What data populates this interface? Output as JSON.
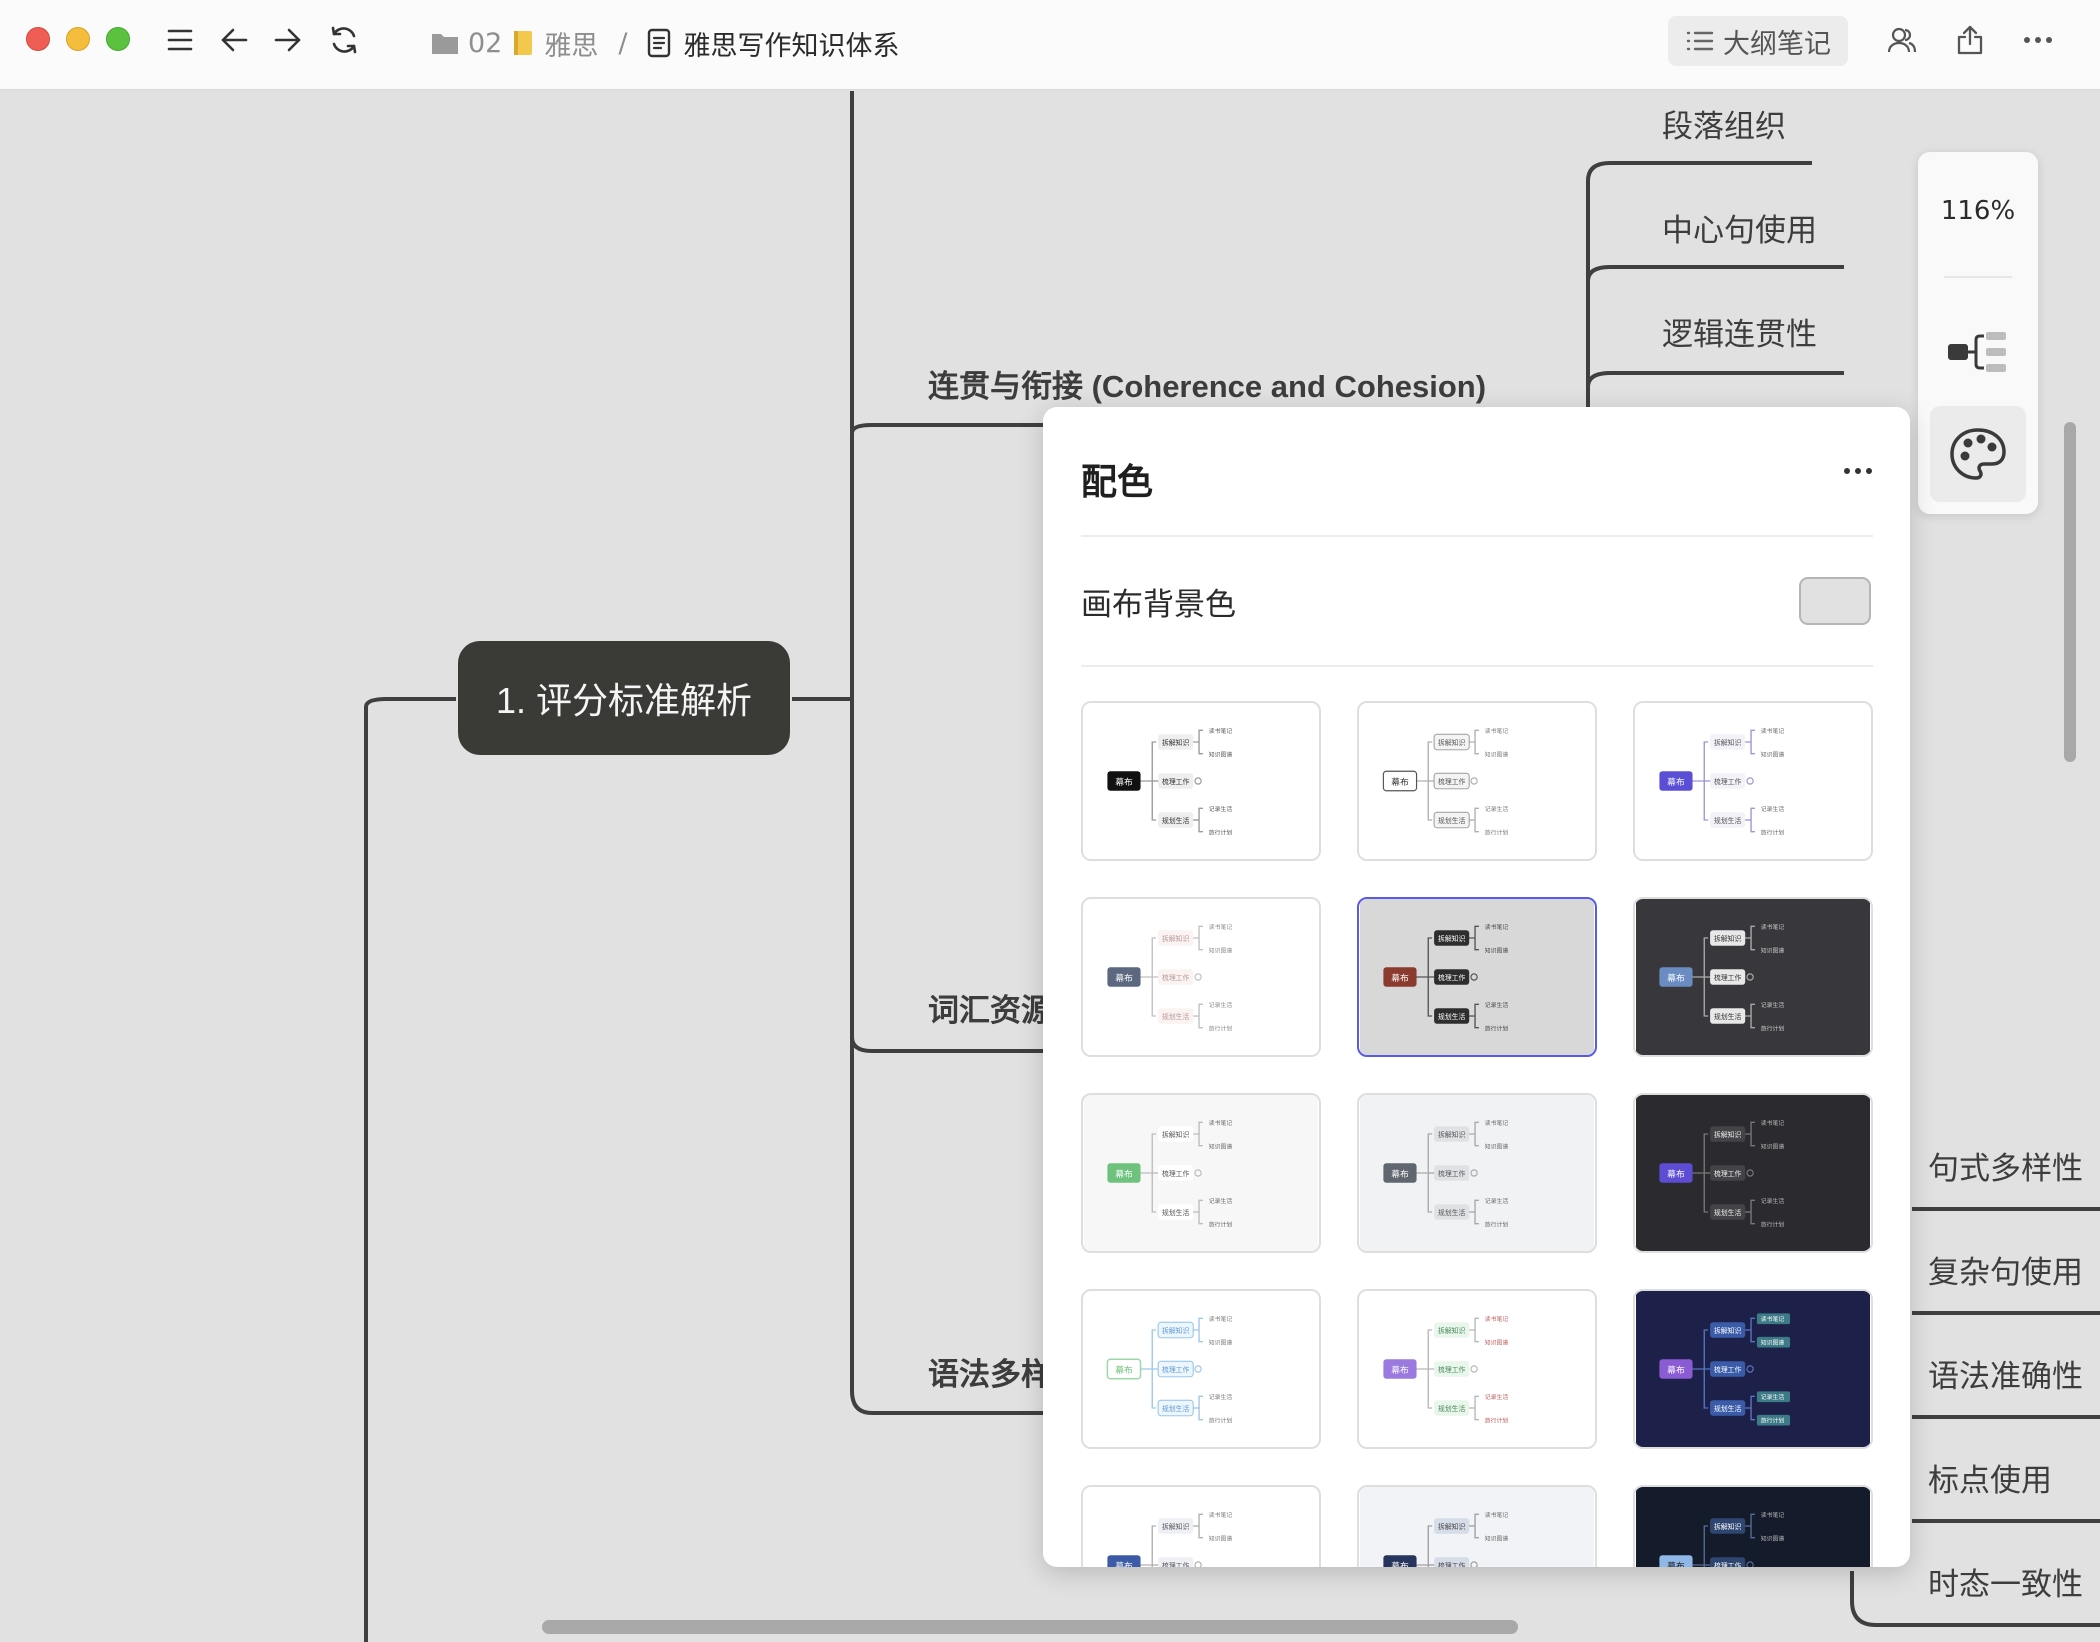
{
  "titlebar": {
    "breadcrumb_folder": "02",
    "breadcrumb_book": "雅思",
    "breadcrumb_separator": "/",
    "breadcrumb_doc": "雅思写作知识体系",
    "outline_button": "大纲笔记"
  },
  "mindmap": {
    "root": "1. 评分标准解析",
    "branch_coherence": "连贯与衔接 (Coherence and Cohesion)",
    "branch_lexical": "词汇资源",
    "branch_grammar": "语法多样",
    "leaf_paragraph": "段落组织",
    "leaf_topic_sentence": "中心句使用",
    "leaf_logic": "逻辑连贯性",
    "leaf_sentence_variety": "句式多样性",
    "leaf_complex": "复杂句使用",
    "leaf_accuracy": "语法准确性",
    "leaf_punctuation": "标点使用",
    "leaf_tense": "时态一致性"
  },
  "sidebar": {
    "zoom": "116%"
  },
  "popup": {
    "title": "配色",
    "background_label": "画布背景色",
    "background_color": "#e1e1e1",
    "selected_theme_index": 4
  },
  "theme_preview_text": {
    "root": "幕布",
    "item1": "拆解知识",
    "item2": "梳理工作",
    "item3": "规划生活",
    "sub1": "读书笔记",
    "sub2": "知识图谱",
    "sub3": "记录生活",
    "sub4": "旅行计划"
  },
  "colors": {
    "titlebar_bg": "#fbfbfb",
    "canvas_bg": "#e1e1e1",
    "root_node_bg": "#3a3a37",
    "selected_border": "#5a5ae8"
  }
}
